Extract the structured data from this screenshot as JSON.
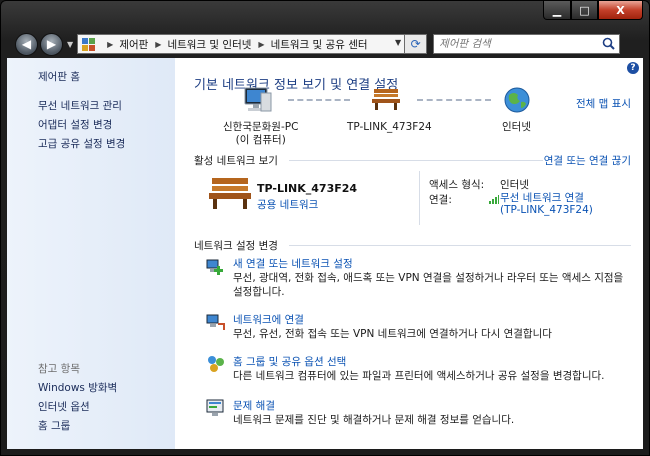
{
  "window": {
    "min_label": "▁",
    "max_label": "□",
    "close_label": "X"
  },
  "address": {
    "crumbs": [
      "제어판",
      "네트워크 및 인터넷",
      "네트워크 및 공유 센터"
    ]
  },
  "search": {
    "placeholder": "제어판 검색"
  },
  "sidebar": {
    "home": "제어판 홈",
    "items": [
      "무선 네트워크 관리",
      "어댑터 설정 변경",
      "고급 공유 설정 변경"
    ],
    "see_also_heading": "참고 항목",
    "see_also": [
      "Windows 방화벽",
      "인터넷 옵션",
      "홈 그룹"
    ]
  },
  "main": {
    "title": "기본 네트워크 정보 보기 및 연결 설정",
    "full_map": "전체 맵 표시",
    "map": {
      "computer_line1": "신한국문화원-PC",
      "computer_line2": "(이 컴퓨터)",
      "network": "TP-LINK_473F24",
      "internet": "인터넷"
    },
    "active": {
      "heading": "활성 네트워크 보기",
      "connect_link": "연결 또는 연결 끊기",
      "network_name": "TP-LINK_473F24",
      "network_type": "공용 네트워크",
      "access_label": "액세스 형식:",
      "access_value": "인터넷",
      "conn_label": "연결:",
      "conn_value_line1": "무선 네트워크 연결",
      "conn_value_line2": "(TP-LINK_473F24)"
    },
    "settings": {
      "heading": "네트워크 설정 변경",
      "tasks": [
        {
          "title": "새 연결 또는 네트워크 설정",
          "desc": "무선, 광대역, 전화 접속, 애드혹 또는 VPN 연결을 설정하거나 라우터 또는 액세스 지점을 설정합니다."
        },
        {
          "title": "네트워크에 연결",
          "desc": "무선, 유선, 전화 접속 또는 VPN 네트워크에 연결하거나 다시 연결합니다"
        },
        {
          "title": "홈 그룹 및 공유 옵션 선택",
          "desc": "다른 네트워크 컴퓨터에 있는 파일과 프린터에 액세스하거나 공유 설정을 변경합니다."
        },
        {
          "title": "문제 해결",
          "desc": "네트워크 문제를 진단 및 해결하거나 문제 해결 정보를 얻습니다."
        }
      ]
    }
  },
  "colors": {
    "link": "#0a52b3",
    "title": "#1e3f84",
    "sidebar_bg": "#e6eef9"
  }
}
